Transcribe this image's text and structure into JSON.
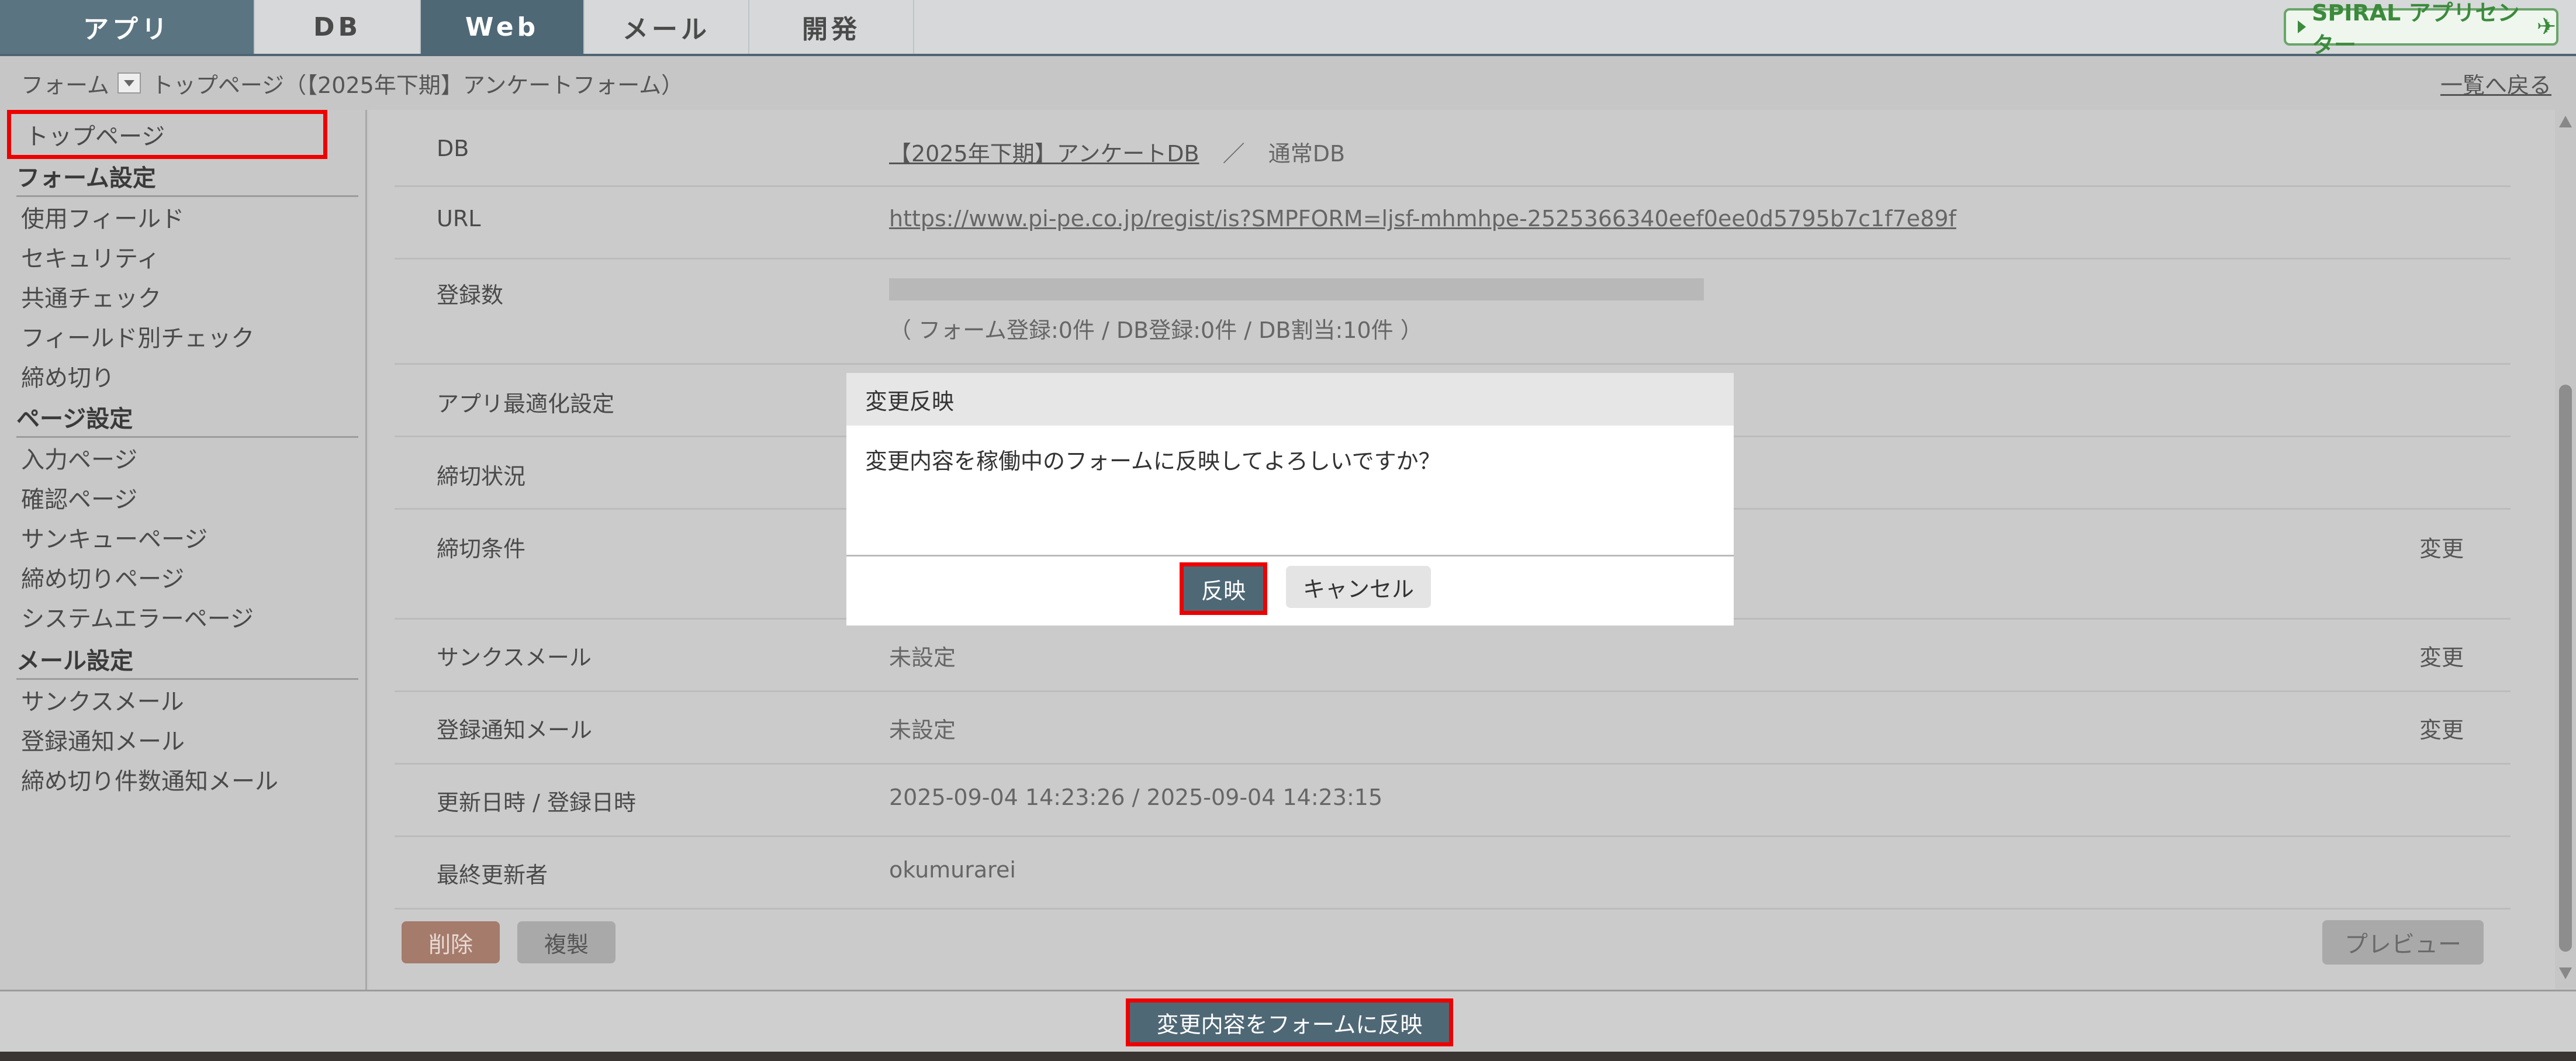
{
  "topnav": {
    "tabs": [
      "アプリ",
      "DB",
      "Web",
      "メール",
      "開発"
    ],
    "brand": "SPIRAL アプリセンター"
  },
  "breadcrumb": {
    "form": "フォーム",
    "page": "トップページ（【2025年下期】アンケートフォーム）",
    "back": "一覧へ戻る"
  },
  "sidebar": {
    "current": "トップページ",
    "form_settings": "フォーム設定",
    "form_items": [
      "使用フィールド",
      "セキュリティ",
      "共通チェック",
      "フィールド別チェック",
      "締め切り"
    ],
    "page_settings": "ページ設定",
    "page_items": [
      "入力ページ",
      "確認ページ",
      "サンキューページ",
      "締め切りページ",
      "システムエラーページ"
    ],
    "mail_settings": "メール設定",
    "mail_items": [
      "サンクスメール",
      "登録通知メール",
      "締め切り件数通知メール"
    ]
  },
  "main": {
    "db_label": "DB",
    "db_link": "【2025年下期】アンケートDB",
    "db_sep": "／",
    "db_type": "通常DB",
    "url_label": "URL",
    "url_value": "https://www.pi-pe.co.jp/regist/is?SMPFORM=ljsf-mhmhpe-2525366340eef0ee0d5795b7c1f7e89f",
    "count_label": "登録数",
    "count_detail": "（ フォーム登録:0件 / DB登録:0件 / DB割当:10件 ）",
    "app_label": "アプリ最適化設定",
    "deadline_status_label": "締切状況",
    "deadline_cond_label": "締切条件",
    "thanks_label": "サンクスメール",
    "thanks_value": "未設定",
    "notify_label": "登録通知メール",
    "notify_value": "未設定",
    "updated_label": "更新日時 / 登録日時",
    "updated_value": "2025-09-04 14:23:26 / 2025-09-04 14:23:15",
    "editor_label": "最終更新者",
    "editor_value": "okumurarei",
    "change": "変更",
    "delete": "削除",
    "copy": "複製",
    "preview": "プレビュー"
  },
  "footer": {
    "apply": "変更内容をフォームに反映"
  },
  "modal": {
    "title": "変更反映",
    "message": "変更内容を稼働中のフォームに反映してよろしいですか？",
    "ok": "反映",
    "cancel": "キャンセル"
  },
  "colors": {
    "active_tab": "#4f6876",
    "highlight": "#e00000",
    "brand_green": "#3c8a3c"
  }
}
